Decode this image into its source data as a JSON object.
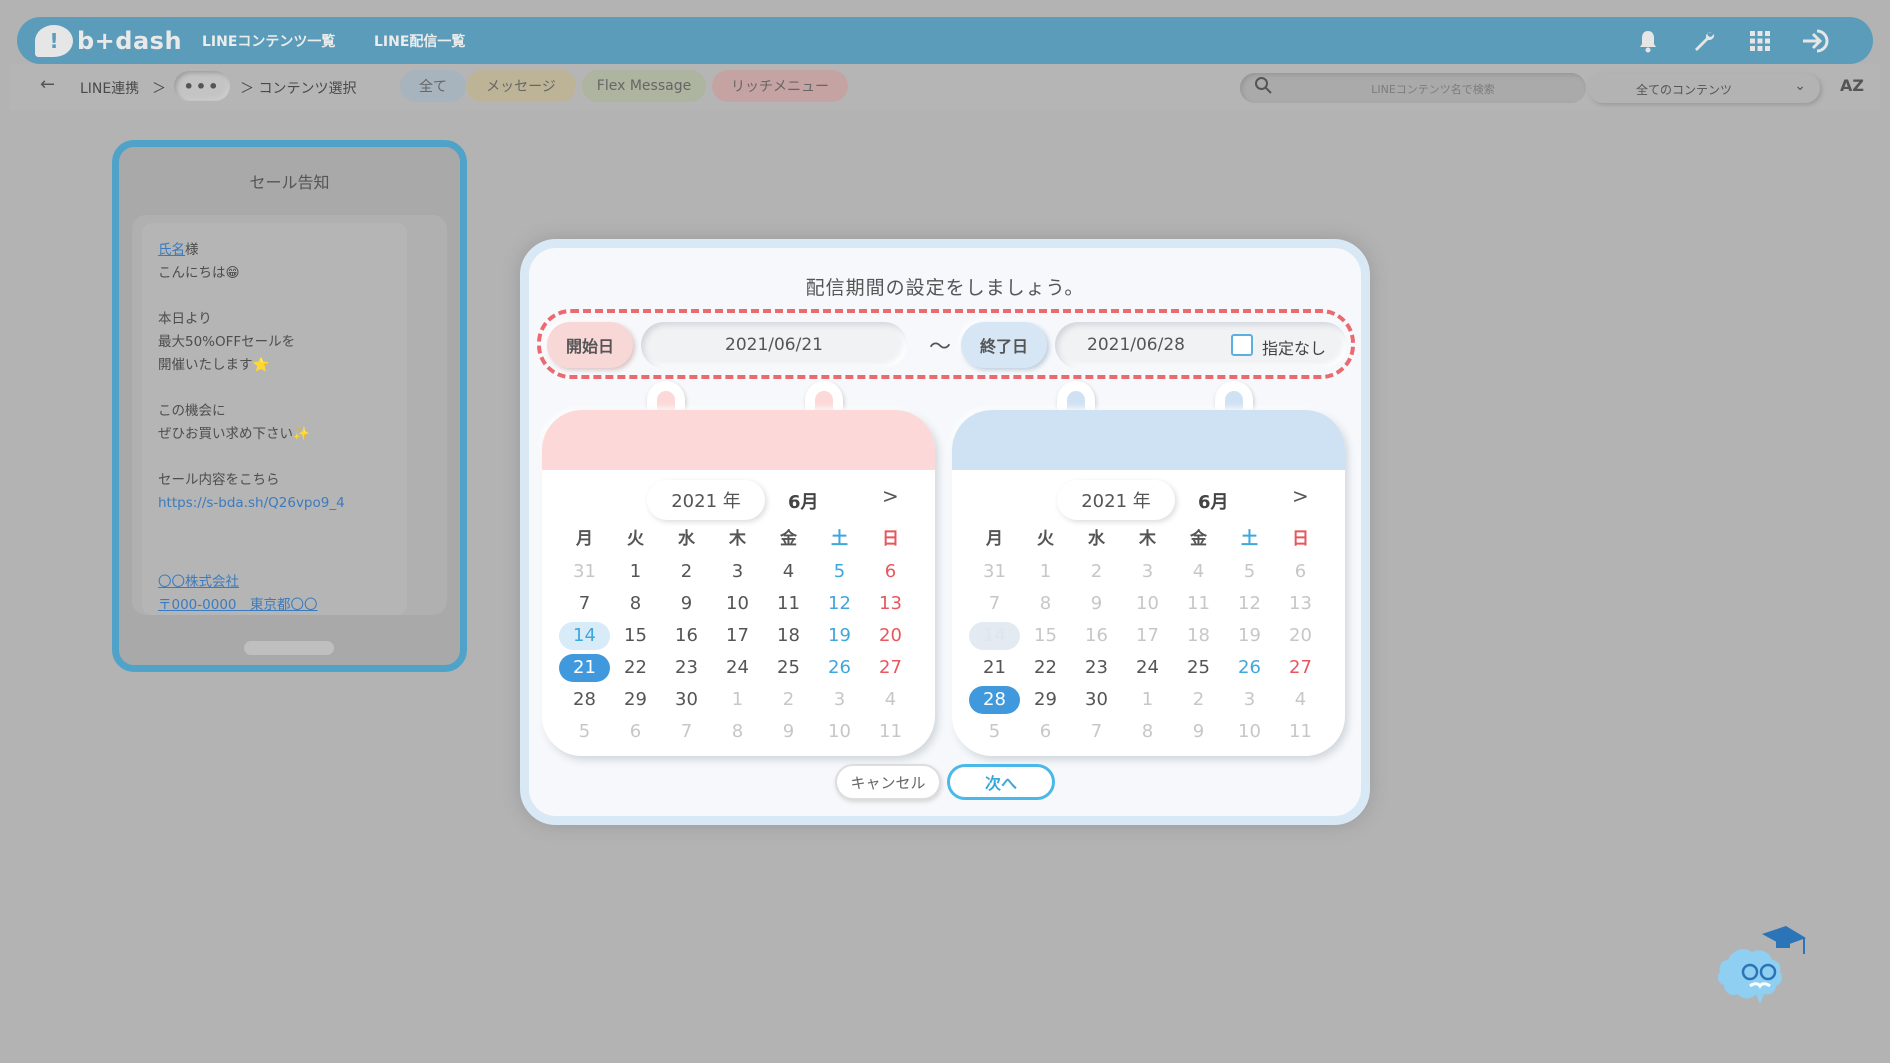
{
  "header": {
    "logo_text": "b+dash",
    "logo_mark": "!",
    "nav": [
      "LINEコンテンツ一覧",
      "LINE配信一覧"
    ],
    "icons": [
      "bell-icon",
      "wrench-icon",
      "apps-grid-icon",
      "logout-icon"
    ]
  },
  "subbar": {
    "breadcrumb": [
      "LINE連携",
      "＞",
      "•••",
      "＞ コンテンツ選択"
    ],
    "tabs": [
      {
        "label": "全て",
        "color": "#a7b3bd"
      },
      {
        "label": "メッセージ",
        "color": "#bdb497"
      },
      {
        "label": "Flex Message",
        "color": "#adb49f"
      },
      {
        "label": "リッチメニュー",
        "color": "#c5a3a3"
      }
    ],
    "search_placeholder": "LINEコンテンツ名で検索",
    "filter_selected": "全てのコンテンツ",
    "sort_label": "AZ"
  },
  "preview": {
    "title": "セール告知",
    "greeting_name": "氏名",
    "greeting_suffix": "様",
    "lines": [
      "こんにちは😁",
      "本日より",
      "最大50%OFFセールを",
      "開催いたします⭐",
      "この機会に",
      "ぜひお買い求め下さい✨",
      "セール内容をこちら"
    ],
    "url": "https://s-bda.sh/Q26vpo9_4",
    "company": "〇〇株式会社",
    "address": "〒000-0000　東京都〇〇"
  },
  "modal": {
    "title": "配信期間の設定をしましょう。",
    "start_label": "開始日",
    "start_date": "2021/06/21",
    "separator": "〜",
    "end_label": "終了日",
    "end_date": "2021/06/28",
    "no_end_label": "指定なし",
    "cancel_label": "キャンセル",
    "next_label": "次へ",
    "weekdays": [
      "月",
      "火",
      "水",
      "木",
      "金",
      "土",
      "日"
    ],
    "calendars": [
      {
        "year": "2021 年",
        "month": "6月",
        "next": ">",
        "today": "14",
        "selected": "21",
        "disabled_before": "none"
      },
      {
        "year": "2021 年",
        "month": "6月",
        "next": ">",
        "today": "14",
        "selected": "28",
        "disabled_before": "21"
      }
    ],
    "weeks": [
      [
        "31",
        "1",
        "2",
        "3",
        "4",
        "5",
        "6"
      ],
      [
        "7",
        "8",
        "9",
        "10",
        "11",
        "12",
        "13"
      ],
      [
        "14",
        "15",
        "16",
        "17",
        "18",
        "19",
        "20"
      ],
      [
        "21",
        "22",
        "23",
        "24",
        "25",
        "26",
        "27"
      ],
      [
        "28",
        "29",
        "30",
        "1",
        "2",
        "3",
        "4"
      ],
      [
        "5",
        "6",
        "7",
        "8",
        "9",
        "10",
        "11"
      ]
    ],
    "colors": {
      "accent": "#4099dd",
      "start": "#fcd9d8",
      "end": "#cfe2f3",
      "dashed": "#ea6a70"
    }
  }
}
